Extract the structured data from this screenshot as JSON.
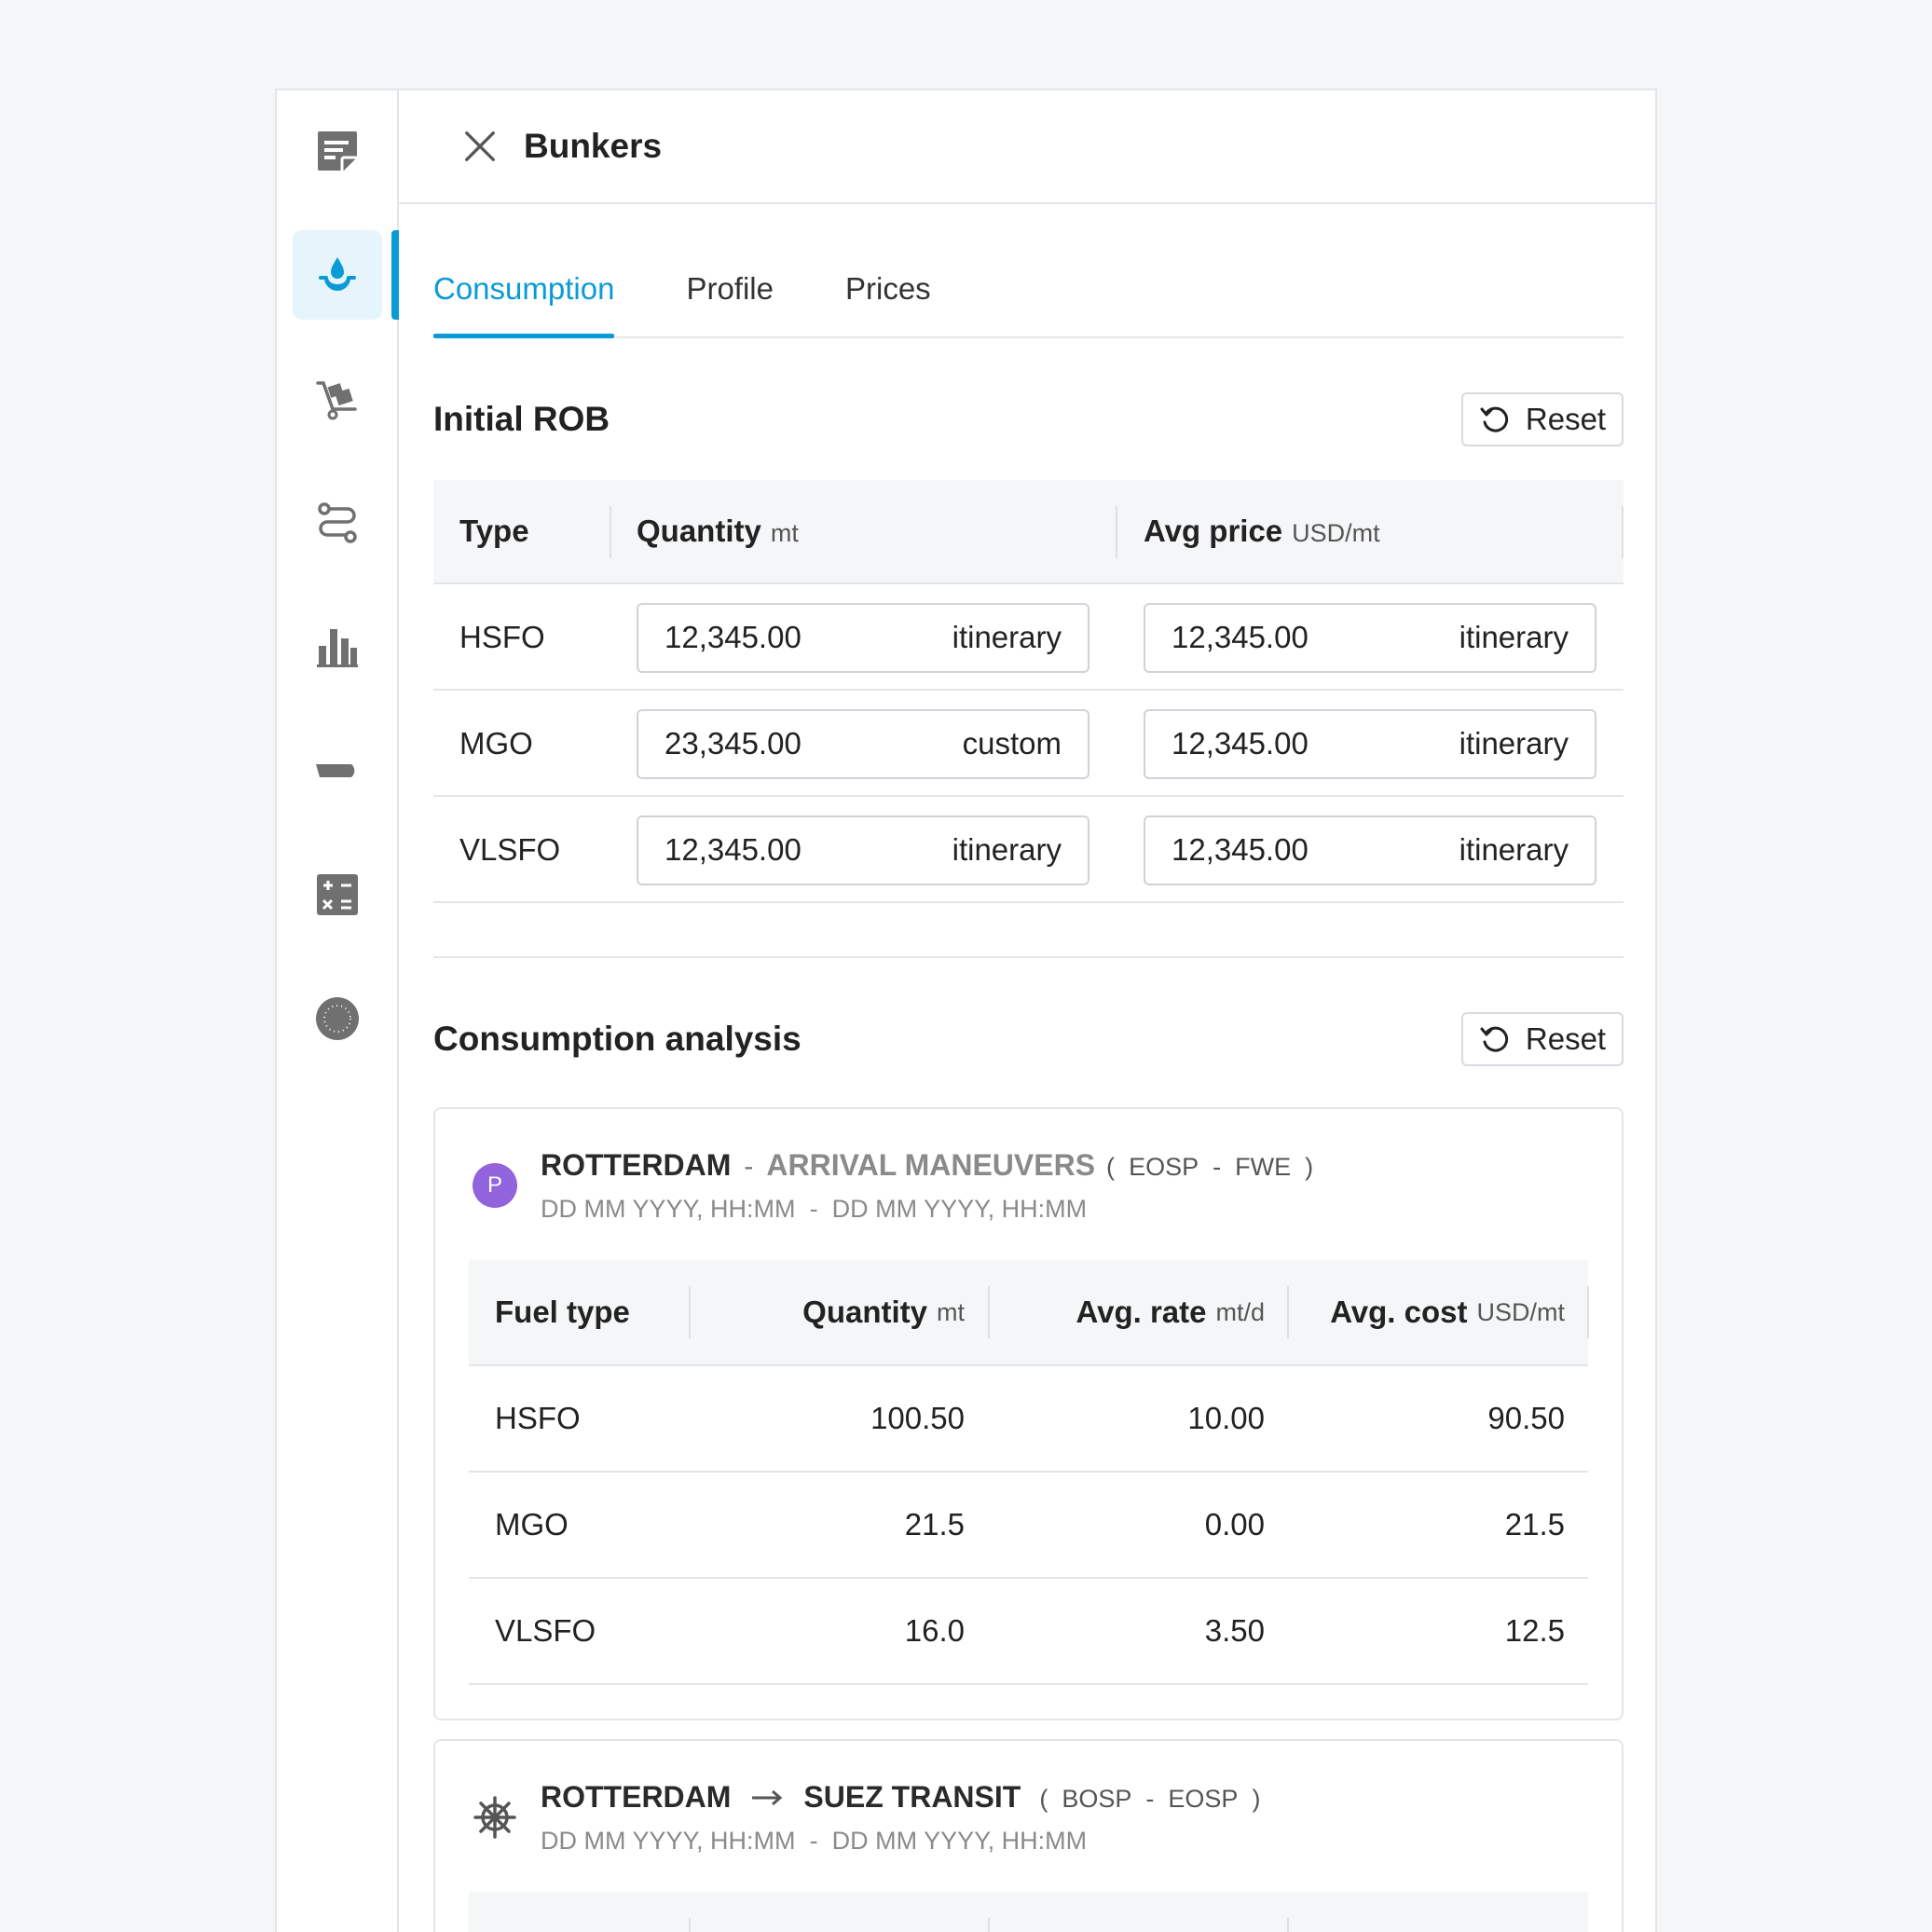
{
  "header": {
    "title": "Bunkers"
  },
  "sidebar": {
    "items": [
      {
        "icon": "notes-icon"
      },
      {
        "icon": "fuel-drop-icon",
        "active": true
      },
      {
        "icon": "cargo-trolley-icon"
      },
      {
        "icon": "route-icon"
      },
      {
        "icon": "bar-chart-icon"
      },
      {
        "icon": "vessel-icon"
      },
      {
        "icon": "calculator-icon"
      },
      {
        "icon": "globe-icon"
      }
    ]
  },
  "tabs": [
    {
      "label": "Consumption",
      "active": true
    },
    {
      "label": "Profile"
    },
    {
      "label": "Prices"
    }
  ],
  "initial_rob": {
    "title": "Initial ROB",
    "reset_label": "Reset",
    "columns": {
      "type": "Type",
      "quantity": "Quantity",
      "quantity_unit": "mt",
      "avg_price": "Avg price",
      "avg_price_unit": "USD/mt"
    },
    "rows": [
      {
        "type": "HSFO",
        "quantity": "12,345.00",
        "quantity_tag": "itinerary",
        "price": "12,345.00",
        "price_tag": "itinerary"
      },
      {
        "type": "MGO",
        "quantity": "23,345.00",
        "quantity_tag": "custom",
        "price": "12,345.00",
        "price_tag": "itinerary"
      },
      {
        "type": "VLSFO",
        "quantity": "12,345.00",
        "quantity_tag": "itinerary",
        "price": "12,345.00",
        "price_tag": "itinerary"
      }
    ]
  },
  "analysis": {
    "title": "Consumption analysis",
    "reset_label": "Reset",
    "columns": {
      "fuel_type": "Fuel type",
      "quantity": "Quantity",
      "quantity_unit": "mt",
      "avg_rate": "Avg. rate",
      "avg_rate_unit": "mt/d",
      "avg_cost": "Avg. cost",
      "avg_cost_unit": "USD/mt"
    },
    "cards": [
      {
        "badge": "P",
        "port": "ROTTERDAM",
        "separator": "-",
        "activity": "ARRIVAL MANEUVERS",
        "event_open": "(",
        "event_from": "EOSP",
        "event_sep": "-",
        "event_to": "FWE",
        "event_close": ")",
        "date_from": "DD MM YYYY, HH:MM",
        "date_sep": "-",
        "date_to": "DD MM YYYY, HH:MM",
        "rows": [
          {
            "fuel": "HSFO",
            "quantity": "100.50",
            "rate": "10.00",
            "cost": "90.50"
          },
          {
            "fuel": "MGO",
            "quantity": "21.5",
            "rate": "0.00",
            "cost": "21.5"
          },
          {
            "fuel": "VLSFO",
            "quantity": "16.0",
            "rate": "3.50",
            "cost": "12.5"
          }
        ]
      },
      {
        "from": "ROTTERDAM",
        "to": "SUEZ TRANSIT",
        "event_open": "(",
        "event_from": "BOSP",
        "event_sep": "-",
        "event_to": "EOSP",
        "event_close": ")",
        "date_from": "DD MM YYYY, HH:MM",
        "date_sep": "-",
        "date_to": "DD MM YYYY, HH:MM"
      }
    ]
  },
  "colors": {
    "accent": "#0a9bd6",
    "badge": "#9163dc",
    "icon_gray": "#707070"
  }
}
